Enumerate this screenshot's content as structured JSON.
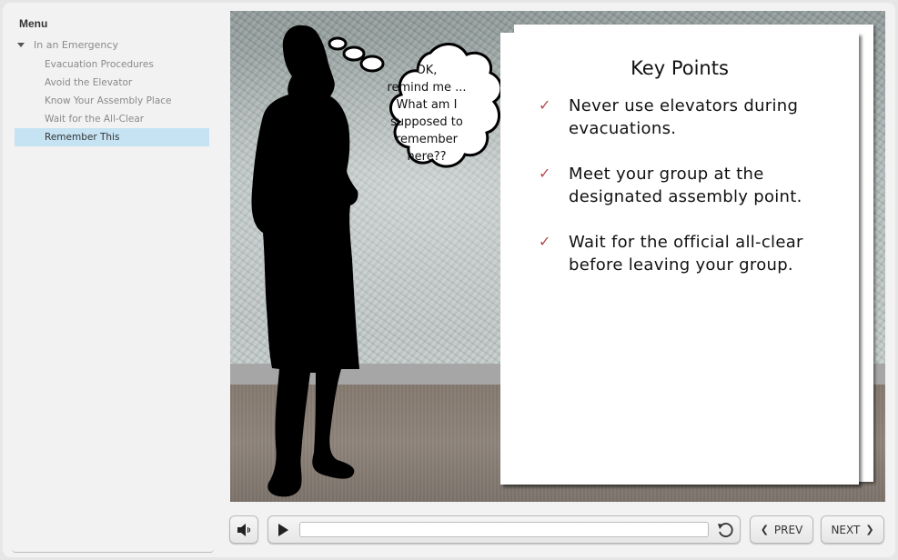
{
  "sidebar": {
    "title": "Menu",
    "section": {
      "label": "In an Emergency",
      "expanded": true,
      "items": [
        {
          "label": "Evacuation Procedures",
          "active": false
        },
        {
          "label": "Avoid the Elevator",
          "active": false
        },
        {
          "label": "Know Your Assembly Place",
          "active": false
        },
        {
          "label": "Wait for the All-Clear",
          "active": false
        },
        {
          "label": "Remember This",
          "active": true
        }
      ]
    }
  },
  "slide": {
    "thought_bubble": "OK,\nremind me ...\nWhat am I\nsupposed to\nremember\nhere??",
    "thought_lines": [
      "OK,",
      "remind me ...",
      "What am I",
      "supposed to",
      "remember",
      "here??"
    ],
    "card": {
      "title": "Key Points",
      "bullet_icon": "check-mark-icon",
      "points": [
        {
          "line1": "Never use elevators during",
          "line2": "evacuations."
        },
        {
          "line1": "Meet your group at the",
          "line2": "designated assembly point."
        },
        {
          "line1": "Wait for the official all-clear",
          "line2": "before leaving your group."
        }
      ]
    }
  },
  "controls": {
    "mute_icon": "speaker-icon",
    "play_icon": "play-icon",
    "replay_icon": "replay-icon",
    "progress_percent": 0,
    "prev_label": "PREV",
    "next_label": "NEXT",
    "prev_icon": "chevron-left-icon",
    "next_icon": "chevron-right-icon"
  },
  "colors": {
    "menu_active_bg": "#c5e3f3",
    "check_color": "#b04a52",
    "panel_bg": "#f2f2f2"
  }
}
